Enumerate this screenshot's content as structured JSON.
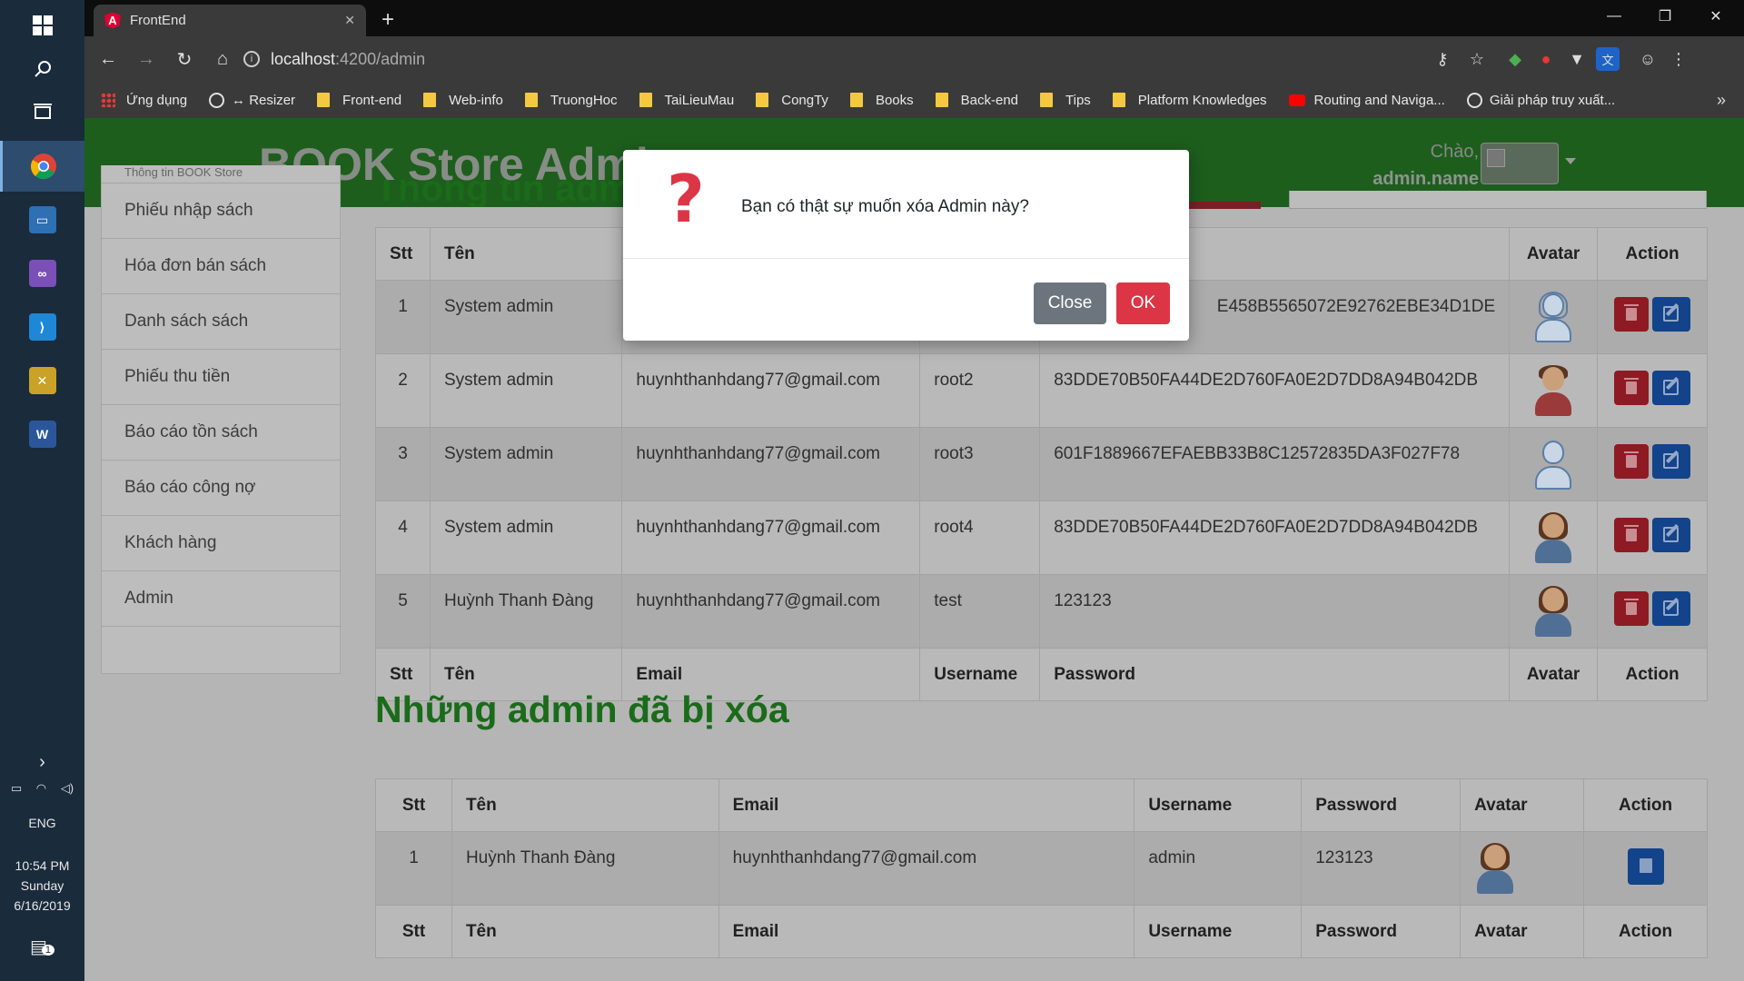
{
  "taskbar": {
    "language": "ENG",
    "time": "10:54 PM",
    "day": "Sunday",
    "date": "6/16/2019",
    "notifications": "1"
  },
  "browser": {
    "tab_title": "FrontEnd",
    "url_host": "localhost",
    "url_path": ":4200/admin",
    "bookmarks": [
      {
        "label": "Ứng dụng",
        "icon": "apps-grid-icon"
      },
      {
        "label": "↔ Resizer",
        "icon": "globe-icon"
      },
      {
        "label": "Front-end",
        "icon": "folder-icon"
      },
      {
        "label": "Web-info",
        "icon": "folder-icon"
      },
      {
        "label": "TruongHoc",
        "icon": "folder-icon"
      },
      {
        "label": "TaiLieuMau",
        "icon": "folder-icon"
      },
      {
        "label": "CongTy",
        "icon": "folder-icon"
      },
      {
        "label": "Books",
        "icon": "folder-icon"
      },
      {
        "label": "Back-end",
        "icon": "folder-icon"
      },
      {
        "label": "Tips",
        "icon": "folder-icon"
      },
      {
        "label": "Platform Knowledges",
        "icon": "folder-icon"
      },
      {
        "label": "Routing and Naviga...",
        "icon": "youtube-icon"
      },
      {
        "label": "Giải pháp truy xuất...",
        "icon": "globe-icon"
      }
    ],
    "more": "»"
  },
  "header": {
    "brand": "BOOK Store Admi",
    "greeting": "Chào,",
    "username": "admin.name"
  },
  "sidebar": {
    "partial_item": "Thông tin BOOK Store",
    "items": [
      "Phiếu nhập sách",
      "Hóa đơn bán sách",
      "Danh sách sách",
      "Phiếu thu tiền",
      "Báo cáo tồn sách",
      "Báo cáo công nợ",
      "Khách hàng",
      "Admin"
    ]
  },
  "active_table": {
    "partial_title": "Thông tin admin",
    "columns": [
      "Stt",
      "Tên",
      "Email",
      "Username",
      "Password",
      "Avatar",
      "Action"
    ],
    "rows": [
      {
        "stt": "1",
        "name": "System admin",
        "email": "",
        "username": "",
        "password": "E458B5565072E92762EBE34D1DE",
        "avatar": "female-blue-avatar-icon"
      },
      {
        "stt": "2",
        "name": "System admin",
        "email": "huynhthanhdang77@gmail.com",
        "username": "root2",
        "password": "83DDE70B50FA44DE2D760FA0E2D7DD8A94B042DB",
        "avatar": "male-red-avatar-icon"
      },
      {
        "stt": "3",
        "name": "System admin",
        "email": "huynhthanhdang77@gmail.com",
        "username": "root3",
        "password": "601F1889667EFAEBB33B8C12572835DA3F027F78",
        "avatar": "male-blue-avatar-icon"
      },
      {
        "stt": "4",
        "name": "System admin",
        "email": "huynhthanhdang77@gmail.com",
        "username": "root4",
        "password": "83DDE70B50FA44DE2D760FA0E2D7DD8A94B042DB",
        "avatar": "female-avatar-icon"
      },
      {
        "stt": "5",
        "name": "Huỳnh Thanh Đàng",
        "email": "huynhthanhdang77@gmail.com",
        "username": "test",
        "password": "123123",
        "avatar": "female-avatar-icon"
      }
    ]
  },
  "deleted_section": {
    "title": "Những admin đã bị xóa",
    "columns": [
      "Stt",
      "Tên",
      "Email",
      "Username",
      "Password",
      "Avatar",
      "Action"
    ],
    "rows": [
      {
        "stt": "1",
        "name": "Huỳnh Thanh Đàng",
        "email": "huynhthanhdang77@gmail.com",
        "username": "admin",
        "password": "123123",
        "avatar": "female-avatar-icon"
      }
    ]
  },
  "modal": {
    "icon": "question-mark-icon",
    "message": "Bạn có thật sự muốn xóa Admin này?",
    "close_label": "Close",
    "ok_label": "OK"
  },
  "colors": {
    "header_green": "#1d5e1d",
    "title_green": "#1a6b1a",
    "danger": "#dc3545",
    "secondary": "#6c757d",
    "primary": "#13438a"
  }
}
